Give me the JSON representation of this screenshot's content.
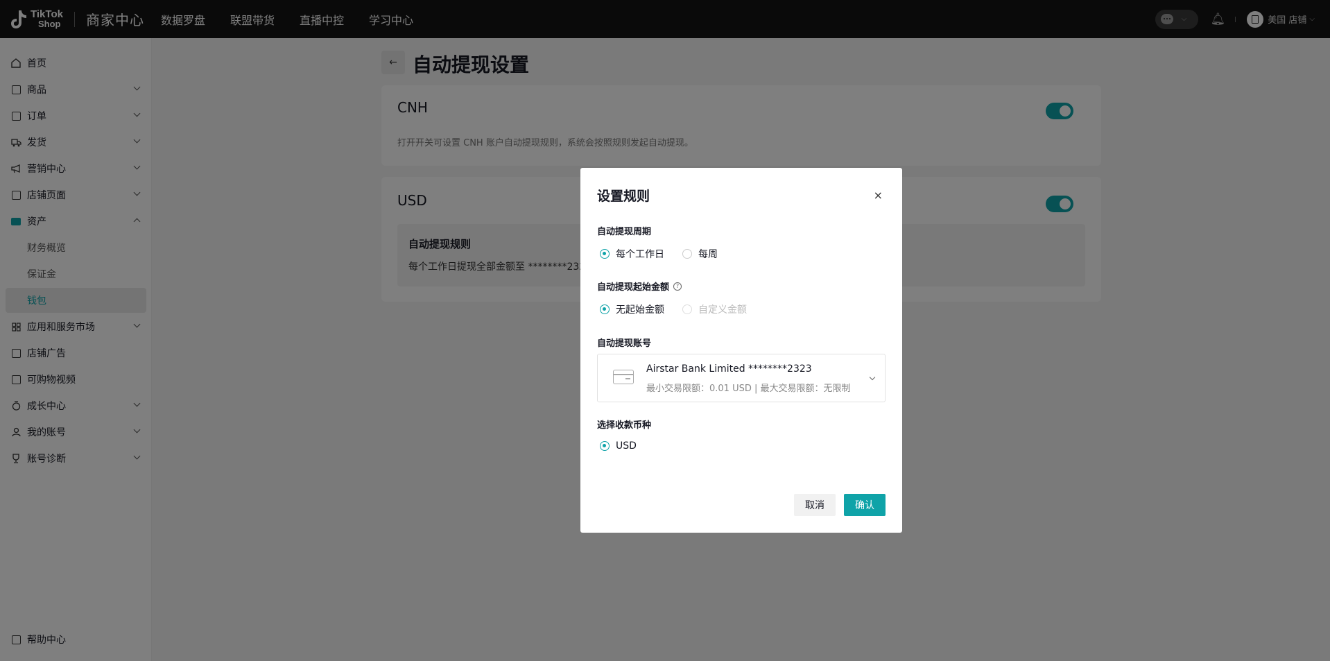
{
  "header": {
    "brand_line1": "TikTok",
    "brand_line2": "Shop",
    "title": "商家中心",
    "nav": [
      "数据罗盘",
      "联盟带货",
      "直播中控",
      "学习中心"
    ],
    "store": "美国 店铺"
  },
  "sidebar": {
    "items": [
      {
        "label": "首页",
        "icon": "home-icon"
      },
      {
        "label": "商品",
        "icon": "product-icon"
      },
      {
        "label": "订单",
        "icon": "order-icon"
      },
      {
        "label": "发货",
        "icon": "truck-icon"
      },
      {
        "label": "营销中心",
        "icon": "megaphone-icon"
      },
      {
        "label": "店铺页面",
        "icon": "store-icon"
      },
      {
        "label": "资产",
        "icon": "wallet-icon"
      },
      {
        "label": "应用和服务市场",
        "icon": "apps-icon"
      },
      {
        "label": "店铺广告",
        "icon": "ad-icon"
      },
      {
        "label": "可购物视频",
        "icon": "video-icon"
      },
      {
        "label": "成长中心",
        "icon": "growth-icon"
      },
      {
        "label": "我的账号",
        "icon": "user-icon"
      },
      {
        "label": "账号诊断",
        "icon": "trophy-icon"
      }
    ],
    "asset_sub": [
      "财务概览",
      "保证金",
      "钱包"
    ],
    "help": "帮助中心"
  },
  "page": {
    "title": "自动提现设置",
    "cnh": {
      "currency": "CNH",
      "desc": "打开开关可设置 CNH 账户自动提现规则，系统会按照规则发起自动提现。",
      "enabled": true
    },
    "usd": {
      "currency": "USD",
      "enabled": true,
      "rule_title": "自动提现规则",
      "rule_desc": "每个工作日提现全部金额至 ********2323"
    }
  },
  "modal": {
    "title": "设置规则",
    "close": "×",
    "period_label": "自动提现周期",
    "period_options": [
      "每个工作日",
      "每周"
    ],
    "period_selected": "每个工作日",
    "start_amount_label": "自动提现起始金额",
    "start_amount_options": [
      "无起始金额",
      "自定义金额"
    ],
    "start_amount_selected": "无起始金额",
    "account_label": "自动提现账号",
    "account_name": "Airstar Bank Limited ********2323",
    "account_limits": "最小交易限额：0.01 USD | 最大交易限额：无限制",
    "currency_label": "选择收款币种",
    "currency_options": [
      "USD"
    ],
    "currency_selected": "USD",
    "cancel": "取消",
    "confirm": "确认"
  },
  "colors": {
    "accent": "#0fa3a8",
    "topbar": "#151515"
  }
}
